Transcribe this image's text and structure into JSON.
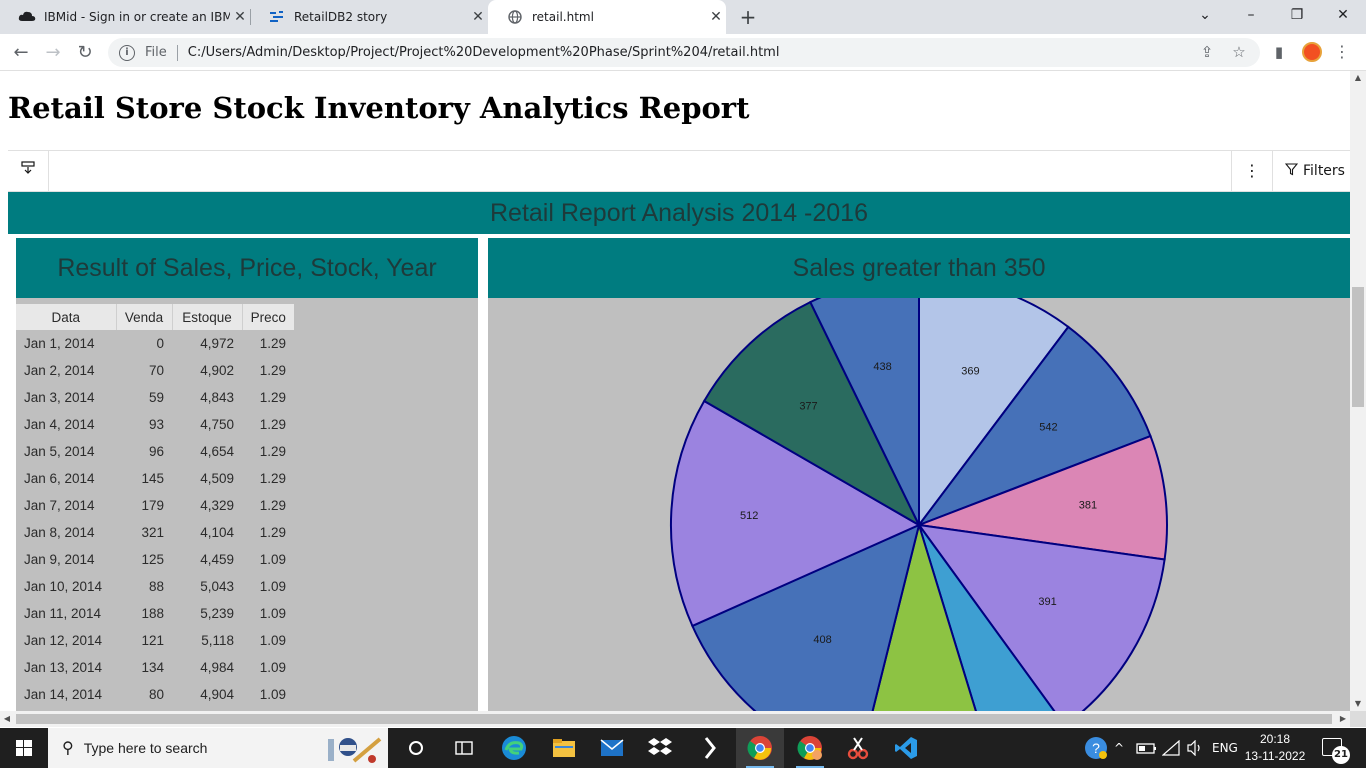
{
  "browser": {
    "tabs": [
      {
        "title": "IBMid - Sign in or create an IBMid",
        "active": false
      },
      {
        "title": "RetailDB2 story",
        "active": false
      },
      {
        "title": "retail.html",
        "active": true
      }
    ],
    "address": {
      "protocol_label": "File",
      "url": "C:/Users/Admin/Desktop/Project/Project%20Development%20Phase/Sprint%204/retail.html"
    }
  },
  "page": {
    "title": "Retail Store Stock Inventory Analytics Report"
  },
  "embed": {
    "filters_label": "Filters"
  },
  "dashboard": {
    "header": "Retail Report Analysis 2014 -2016",
    "left_panel": {
      "title": "Result of Sales, Price, Stock, Year",
      "columns": [
        "Data",
        "Venda",
        "Estoque",
        "Preco"
      ],
      "rows": [
        [
          "Jan 1, 2014",
          "0",
          "4,972",
          "1.29"
        ],
        [
          "Jan 2, 2014",
          "70",
          "4,902",
          "1.29"
        ],
        [
          "Jan 3, 2014",
          "59",
          "4,843",
          "1.29"
        ],
        [
          "Jan 4, 2014",
          "93",
          "4,750",
          "1.29"
        ],
        [
          "Jan 5, 2014",
          "96",
          "4,654",
          "1.29"
        ],
        [
          "Jan 6, 2014",
          "145",
          "4,509",
          "1.29"
        ],
        [
          "Jan 7, 2014",
          "179",
          "4,329",
          "1.29"
        ],
        [
          "Jan 8, 2014",
          "321",
          "4,104",
          "1.29"
        ],
        [
          "Jan 9, 2014",
          "125",
          "4,459",
          "1.09"
        ],
        [
          "Jan 10, 2014",
          "88",
          "5,043",
          "1.09"
        ],
        [
          "Jan 11, 2014",
          "188",
          "5,239",
          "1.09"
        ],
        [
          "Jan 12, 2014",
          "121",
          "5,118",
          "1.09"
        ],
        [
          "Jan 13, 2014",
          "134",
          "4,984",
          "1.09"
        ],
        [
          "Jan 14, 2014",
          "80",
          "4,904",
          "1.09"
        ]
      ]
    },
    "right_panel": {
      "title": "Sales greater than 350"
    }
  },
  "chart_data": {
    "type": "pie",
    "title": "Sales greater than 350",
    "slice_colors": [
      "#b3c5e8",
      "#4671b8",
      "#db86b5",
      "#9b83e0",
      "#3e9fd2",
      "#8dc343",
      "#4671b8",
      "#9b83e0",
      "#2a6b5f",
      "#4671b8"
    ],
    "slices": [
      {
        "value": 369,
        "label": "369"
      },
      {
        "value": 542,
        "label": "542"
      },
      {
        "value": 381,
        "label": "381"
      },
      {
        "value": 391,
        "label": "391"
      },
      {
        "value": null,
        "label": ""
      },
      {
        "value": null,
        "label": ""
      },
      {
        "value": 408,
        "label": "408"
      },
      {
        "value": 512,
        "label": "512"
      },
      {
        "value": 377,
        "label": "377"
      },
      {
        "value": 438,
        "label": "438"
      }
    ],
    "slice_outline_color": "#000080"
  },
  "taskbar": {
    "search_placeholder": "Type here to search",
    "language": "ENG",
    "time": "20:18",
    "date": "13-11-2022",
    "notification_count": "21"
  }
}
